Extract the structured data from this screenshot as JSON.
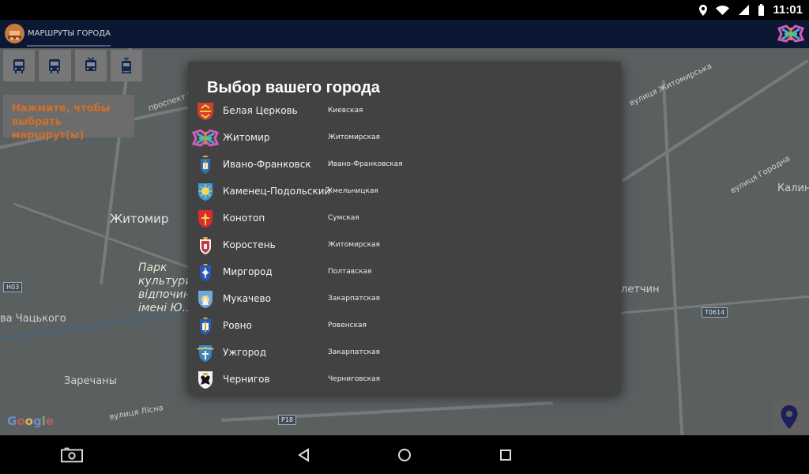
{
  "status_bar": {
    "time": "11:01"
  },
  "app_bar": {
    "title": "МАРШРУТЫ ГОРОДА"
  },
  "transport_buttons": [
    {
      "icon": "bus-icon"
    },
    {
      "icon": "bus-icon"
    },
    {
      "icon": "trolleybus-icon"
    },
    {
      "icon": "tram-icon"
    }
  ],
  "hint": {
    "line1": "Нажмите, чтобы",
    "line2": "выбрать маршрут(ы)"
  },
  "map": {
    "city_label": "Житомир",
    "park_lines": [
      "Парк",
      "культури",
      "відпочинку",
      "імені Ю..."
    ],
    "labels": {
      "zarechany": "Заречаны",
      "chatsky": "ва Чацького",
      "kalino": "Калинс",
      "letchin": "летчин",
      "street_zhytomyrska": "вулиця Житомирська",
      "street_horodna": "вулиця Городна",
      "street_prospekt": "проспект Незалежності",
      "street_lisna": "вулиця Лісна"
    },
    "road_badges": {
      "n03": "Н03",
      "t0614": "Т0614",
      "p18": "Р18"
    },
    "google_logo": "Google"
  },
  "dialog": {
    "title": "Выбор вашего города",
    "cities": [
      {
        "name": "Белая Церковь",
        "region": "Киевская",
        "crest": "belaya-tserkov-crest-icon"
      },
      {
        "name": "Житомир",
        "region": "Житомирская",
        "crest": "zhytomyr-brand-icon"
      },
      {
        "name": "Ивано-Франковск",
        "region": "Ивано-Франковская",
        "crest": "ivano-frankivsk-crest-icon"
      },
      {
        "name": "Каменец-Подольский",
        "region": "Хмельницкая",
        "crest": "kamianets-crest-icon"
      },
      {
        "name": "Конотоп",
        "region": "Сумская",
        "crest": "konotop-crest-icon"
      },
      {
        "name": "Коростень",
        "region": "Житомирская",
        "crest": "korosten-crest-icon"
      },
      {
        "name": "Миргород",
        "region": "Полтавская",
        "crest": "myrhorod-crest-icon"
      },
      {
        "name": "Мукачево",
        "region": "Закарпатская",
        "crest": "mukachevo-crest-icon"
      },
      {
        "name": "Ровно",
        "region": "Ровенская",
        "crest": "rivne-crest-icon"
      },
      {
        "name": "Ужгород",
        "region": "Закарпатская",
        "crest": "uzhhorod-crest-icon"
      },
      {
        "name": "Чернигов",
        "region": "Черниговская",
        "crest": "chernihiv-crest-icon"
      }
    ]
  },
  "colors": {
    "dialog_background": "#424242",
    "app_bar": "#0b1733",
    "hint_text": "#d26f2b",
    "map_background": "#5a5f60"
  }
}
